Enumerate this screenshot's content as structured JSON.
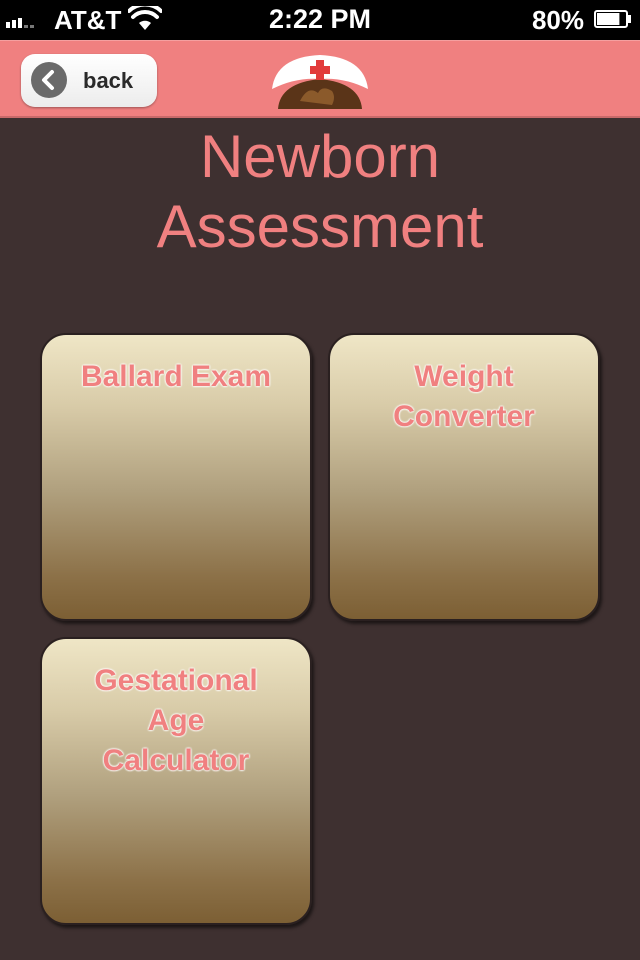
{
  "status_bar": {
    "carrier": "AT&T",
    "time": "2:22 PM",
    "battery": "80%",
    "battery_level": 0.8,
    "signal_icon": "signal-icon",
    "wifi_icon": "wifi-icon",
    "battery_icon": "battery-icon"
  },
  "nav": {
    "back_label": "back",
    "back_icon": "chevron-left-icon",
    "logo_icon": "nurse-cap-icon"
  },
  "title": {
    "line1": "Newborn",
    "line2": "Assessment"
  },
  "tiles": [
    {
      "label": "Ballard Exam"
    },
    {
      "label": "Weight Converter"
    },
    {
      "label": "Gestational Age Calculator"
    }
  ],
  "colors": {
    "accent": "#f08080",
    "background": "#3e3030",
    "tile_top": "#efe6c6",
    "tile_bottom": "#7c5f34"
  }
}
